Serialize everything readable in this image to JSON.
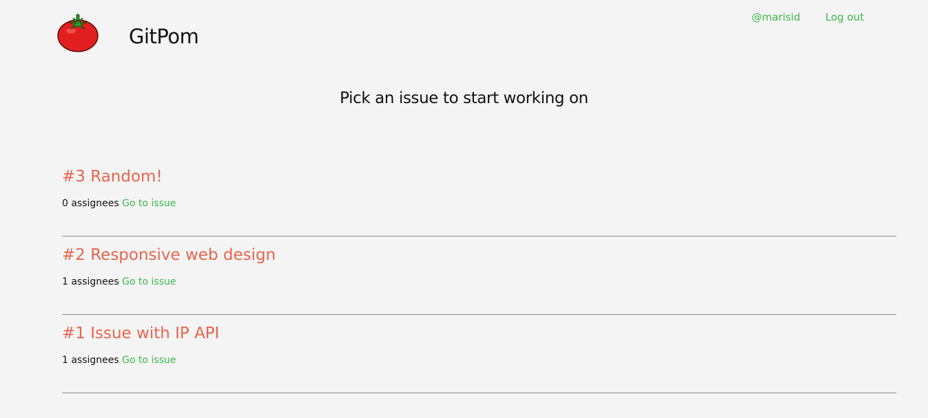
{
  "header": {
    "brand": "GitPom",
    "logo_icon": "tomato-icon",
    "nav": {
      "user": "@marisid",
      "logout": "Log out"
    }
  },
  "main": {
    "title": "Pick an issue to start working on",
    "issues": [
      {
        "title": "#3 Random!",
        "assignees": "0 assignees",
        "link": "Go to issue"
      },
      {
        "title": "#2 Responsive web design",
        "assignees": "1 assignees",
        "link": "Go to issue"
      },
      {
        "title": "#1 Issue with IP API",
        "assignees": "1 assignees",
        "link": "Go to issue"
      }
    ]
  },
  "colors": {
    "background": "#f4f4f4",
    "accent_green": "#3cb84a",
    "issue_title": "#e8644c",
    "divider": "#8a8a8a"
  }
}
